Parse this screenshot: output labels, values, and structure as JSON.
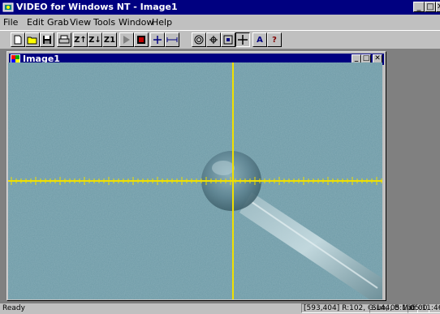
{
  "app": {
    "title": "VIDEO for Windows NT - Image1",
    "window_controls": [
      "_",
      "□",
      "✕"
    ]
  },
  "menu": {
    "items": [
      {
        "key": "file",
        "label": "File"
      },
      {
        "key": "edit",
        "label": "Edit"
      },
      {
        "key": "grab",
        "label": "Grab"
      },
      {
        "key": "view",
        "label": "View"
      },
      {
        "key": "tools",
        "label": "Tools"
      },
      {
        "key": "window",
        "label": "Window"
      },
      {
        "key": "help",
        "label": "Help"
      }
    ]
  },
  "toolbar": {
    "buttons": [
      {
        "name": "new-file-icon"
      },
      {
        "name": "open-folder-icon"
      },
      {
        "name": "save-disk-icon"
      },
      {
        "name": "print-icon"
      },
      {
        "name": "zoom-in-icon",
        "label": "Z↑"
      },
      {
        "name": "zoom-out-icon",
        "label": "Z↓"
      },
      {
        "name": "zoom-one-icon",
        "label": "Z1"
      },
      {
        "name": "play-icon"
      },
      {
        "name": "record-icon"
      },
      {
        "name": "crosshair-small-icon"
      },
      {
        "name": "measure-icon"
      },
      {
        "name": "target-icon"
      },
      {
        "name": "move-icon"
      },
      {
        "name": "frame-icon"
      },
      {
        "name": "cross-icon"
      },
      {
        "name": "text-icon",
        "label": "A"
      },
      {
        "name": "help-icon",
        "label": "?"
      }
    ]
  },
  "child_window": {
    "title": "Image1",
    "controls": [
      "_",
      "□",
      "✕"
    ]
  },
  "video": {
    "background_color": "#6e9aa6",
    "crosshair_color": "#f0e000"
  },
  "status": {
    "ready": "Ready",
    "coords": "[593,404] R:102, G:144, B:165",
    "date": "Sun, 05 Mar 00",
    "time": "05:11:46 PM"
  },
  "colors": {
    "titlebar": "#000080",
    "face": "#c0c0c0",
    "mdi_bg": "#808080"
  }
}
